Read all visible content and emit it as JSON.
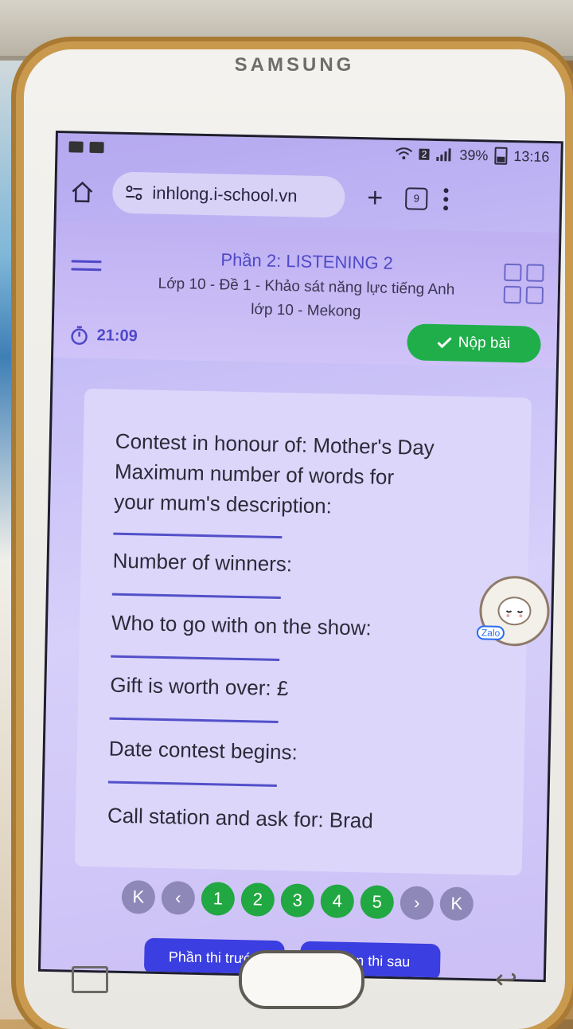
{
  "device": {
    "brand": "SAMSUNG"
  },
  "status_bar": {
    "sim_indicator": "2",
    "battery": "39%",
    "time": "13:16",
    "icons": [
      "image-icon",
      "zalo-notification-icon",
      "wifi-icon",
      "signal-icon",
      "battery-icon"
    ]
  },
  "browser": {
    "url": "inhlong.i-school.vn",
    "tab_count": "9",
    "icons": [
      "home-icon",
      "site-settings-icon",
      "plus-icon",
      "kebab-menu-icon"
    ]
  },
  "header": {
    "section_title": "Phần 2: LISTENING 2",
    "subtitle_line1": "Lớp 10 - Đề 1 - Khảo sát năng lực tiếng Anh",
    "subtitle_line2": "lớp 10 - Mekong",
    "timer": "21:09",
    "submit_label": "Nộp bài"
  },
  "content": {
    "lines": [
      "Contest in honour of: Mother's Day",
      "Maximum number of words for",
      "your mum's description:",
      "Number of winners:",
      "Who to go with on the show:",
      "Gift is worth over: £",
      "Date contest begins:",
      "Call station and ask for: Brad"
    ]
  },
  "pagination": {
    "pages": [
      "1",
      "2",
      "3",
      "4",
      "5"
    ],
    "first_icon": "K",
    "prev_icon": "‹",
    "next_icon": "›",
    "last_icon": "K"
  },
  "footer": {
    "prev_part": "Phần thi trước",
    "next_part": "Phần thi sau"
  },
  "zalo": {
    "label": "Zalo"
  },
  "colors": {
    "accent": "#4f48c8",
    "submit_green": "#1fae4a",
    "page_green": "#21a842",
    "footer_blue": "#3b3ee0"
  }
}
